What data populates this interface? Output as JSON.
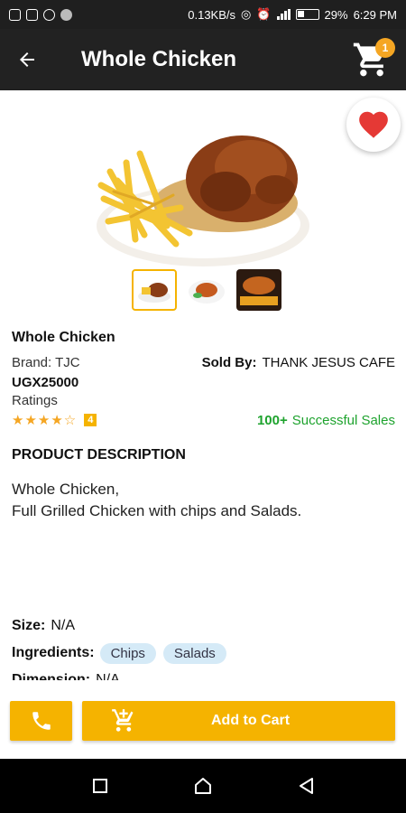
{
  "status_bar": {
    "speed": "0.13KB/s",
    "battery": "29%",
    "time": "6:29 PM"
  },
  "app_bar": {
    "title": "Whole Chicken",
    "cart_count": "1"
  },
  "product": {
    "name": "Whole Chicken",
    "brand": "Brand: TJC",
    "sold_by_label": "Sold By:",
    "sold_by_value": "THANK JESUS CAFE",
    "price": "UGX25000",
    "ratings_label": "Ratings",
    "stars_filled": 4,
    "stars_total": 5,
    "rating_badge": "4",
    "sales_count": "100+",
    "sales_label": "Successful Sales"
  },
  "description": {
    "heading": "PRODUCT DESCRIPTION",
    "line1": "Whole Chicken,",
    "line2": "Full Grilled Chicken with chips and Salads."
  },
  "attributes": {
    "size_label": "Size:",
    "size_value": "N/A",
    "ingredients_label": "Ingredients:",
    "ingredients": [
      "Chips",
      "Salads"
    ],
    "dimension_label": "Dimension:",
    "dimension_value": "N/A"
  },
  "actions": {
    "add_to_cart": "Add to Cart"
  },
  "colors": {
    "accent": "#f5b300",
    "appbar": "#222222",
    "favorite": "#e53935",
    "sales_green": "#1ea32e",
    "chip": "#d5eaf7"
  }
}
